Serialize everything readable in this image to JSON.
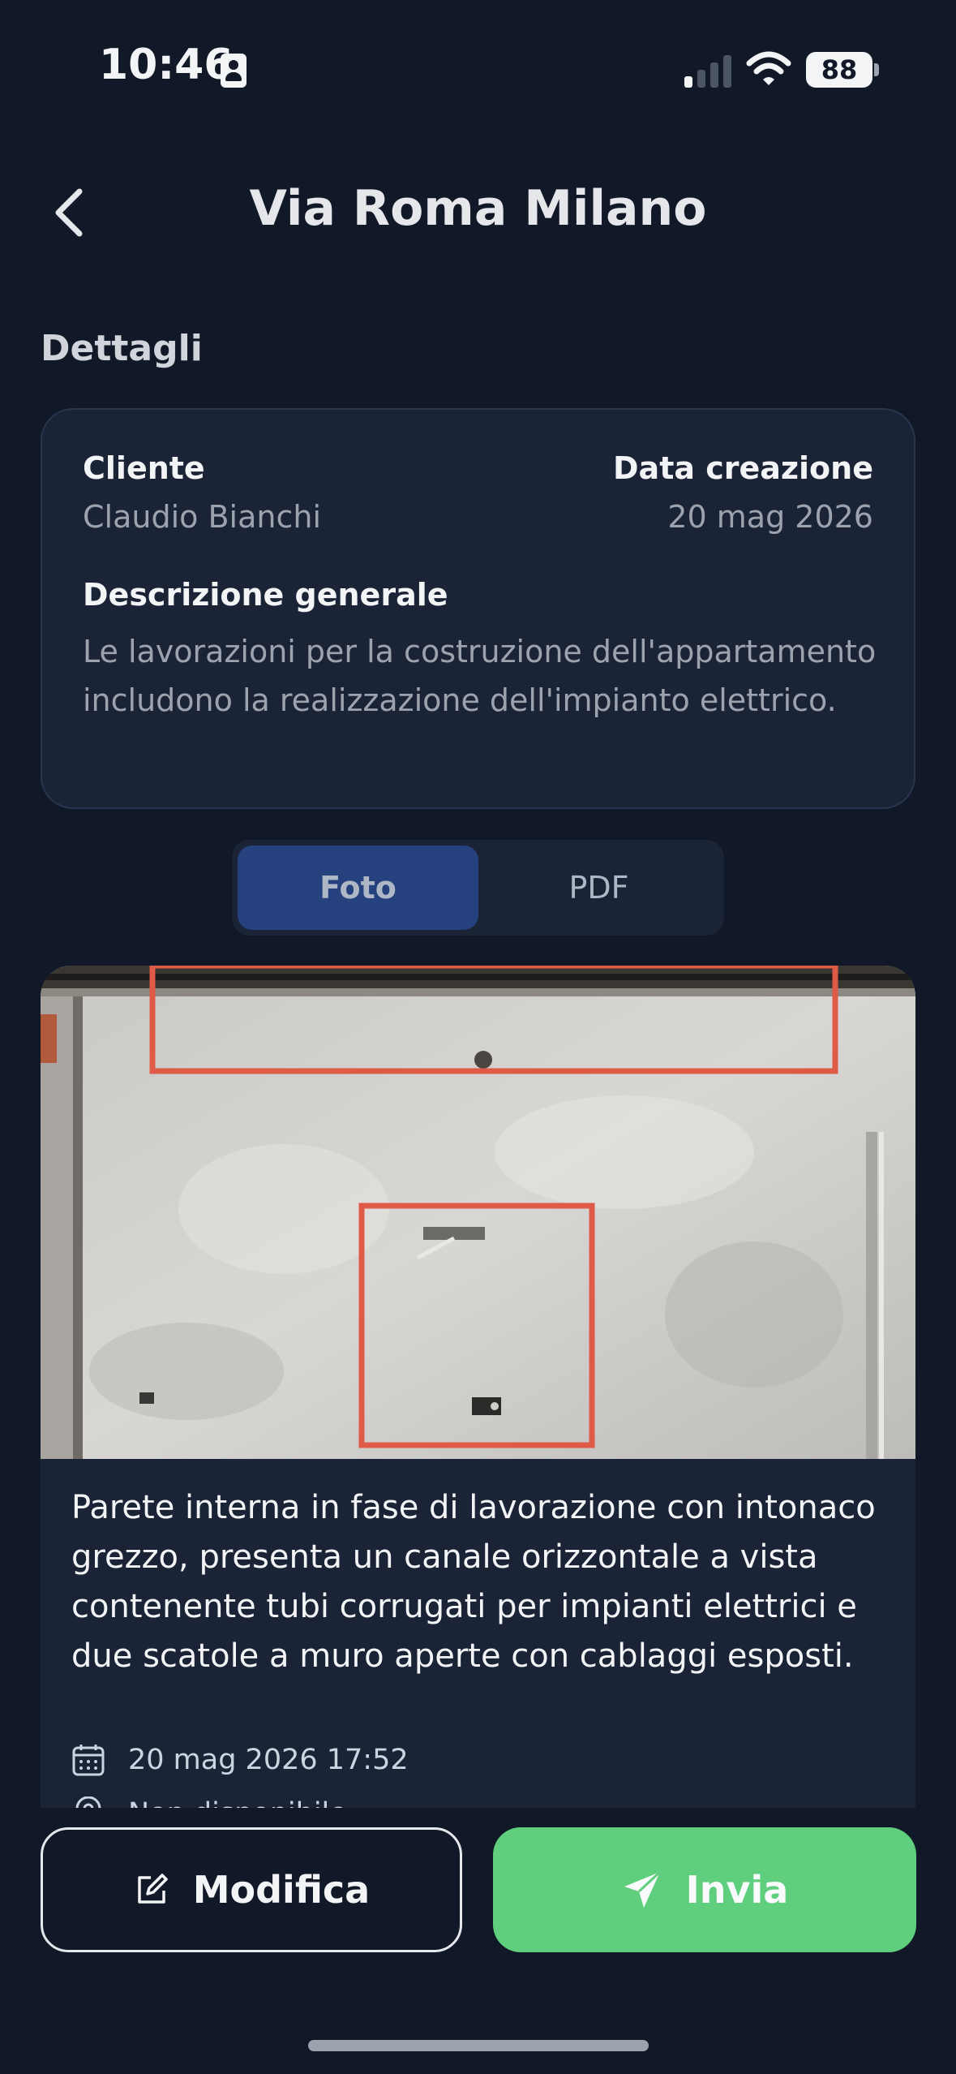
{
  "status_bar": {
    "time": "10:46",
    "battery": "88"
  },
  "header": {
    "title": "Via Roma Milano"
  },
  "details": {
    "section_title": "Dettagli",
    "client_label": "Cliente",
    "client_value": "Claudio Bianchi",
    "date_label": "Data creazione",
    "date_value": "20 mag 2026",
    "description_label": "Descrizione generale",
    "description_value": "Le lavorazioni per la costruzione dell'appartamento includono la realizzazione dell'impianto elettrico."
  },
  "tabs": [
    {
      "label": "Foto",
      "active": true
    },
    {
      "label": "PDF",
      "active": false
    }
  ],
  "photo": {
    "caption": "Parete interna in fase di lavorazione con intonaco grezzo, presenta un canale orizzontale a vista contenente tubi corrugati per impianti elettrici e due scatole a muro aperte con cablaggi esposti.",
    "date": "20 mag 2026 17:52",
    "location": "Non disponibile"
  },
  "actions": {
    "edit_label": "Modifica",
    "send_label": "Invia"
  },
  "colors": {
    "background": "#111827",
    "card": "#1b2437",
    "tab_active": "#25427e",
    "send_button": "#5fcf7e",
    "annotation": "#e05a48"
  }
}
